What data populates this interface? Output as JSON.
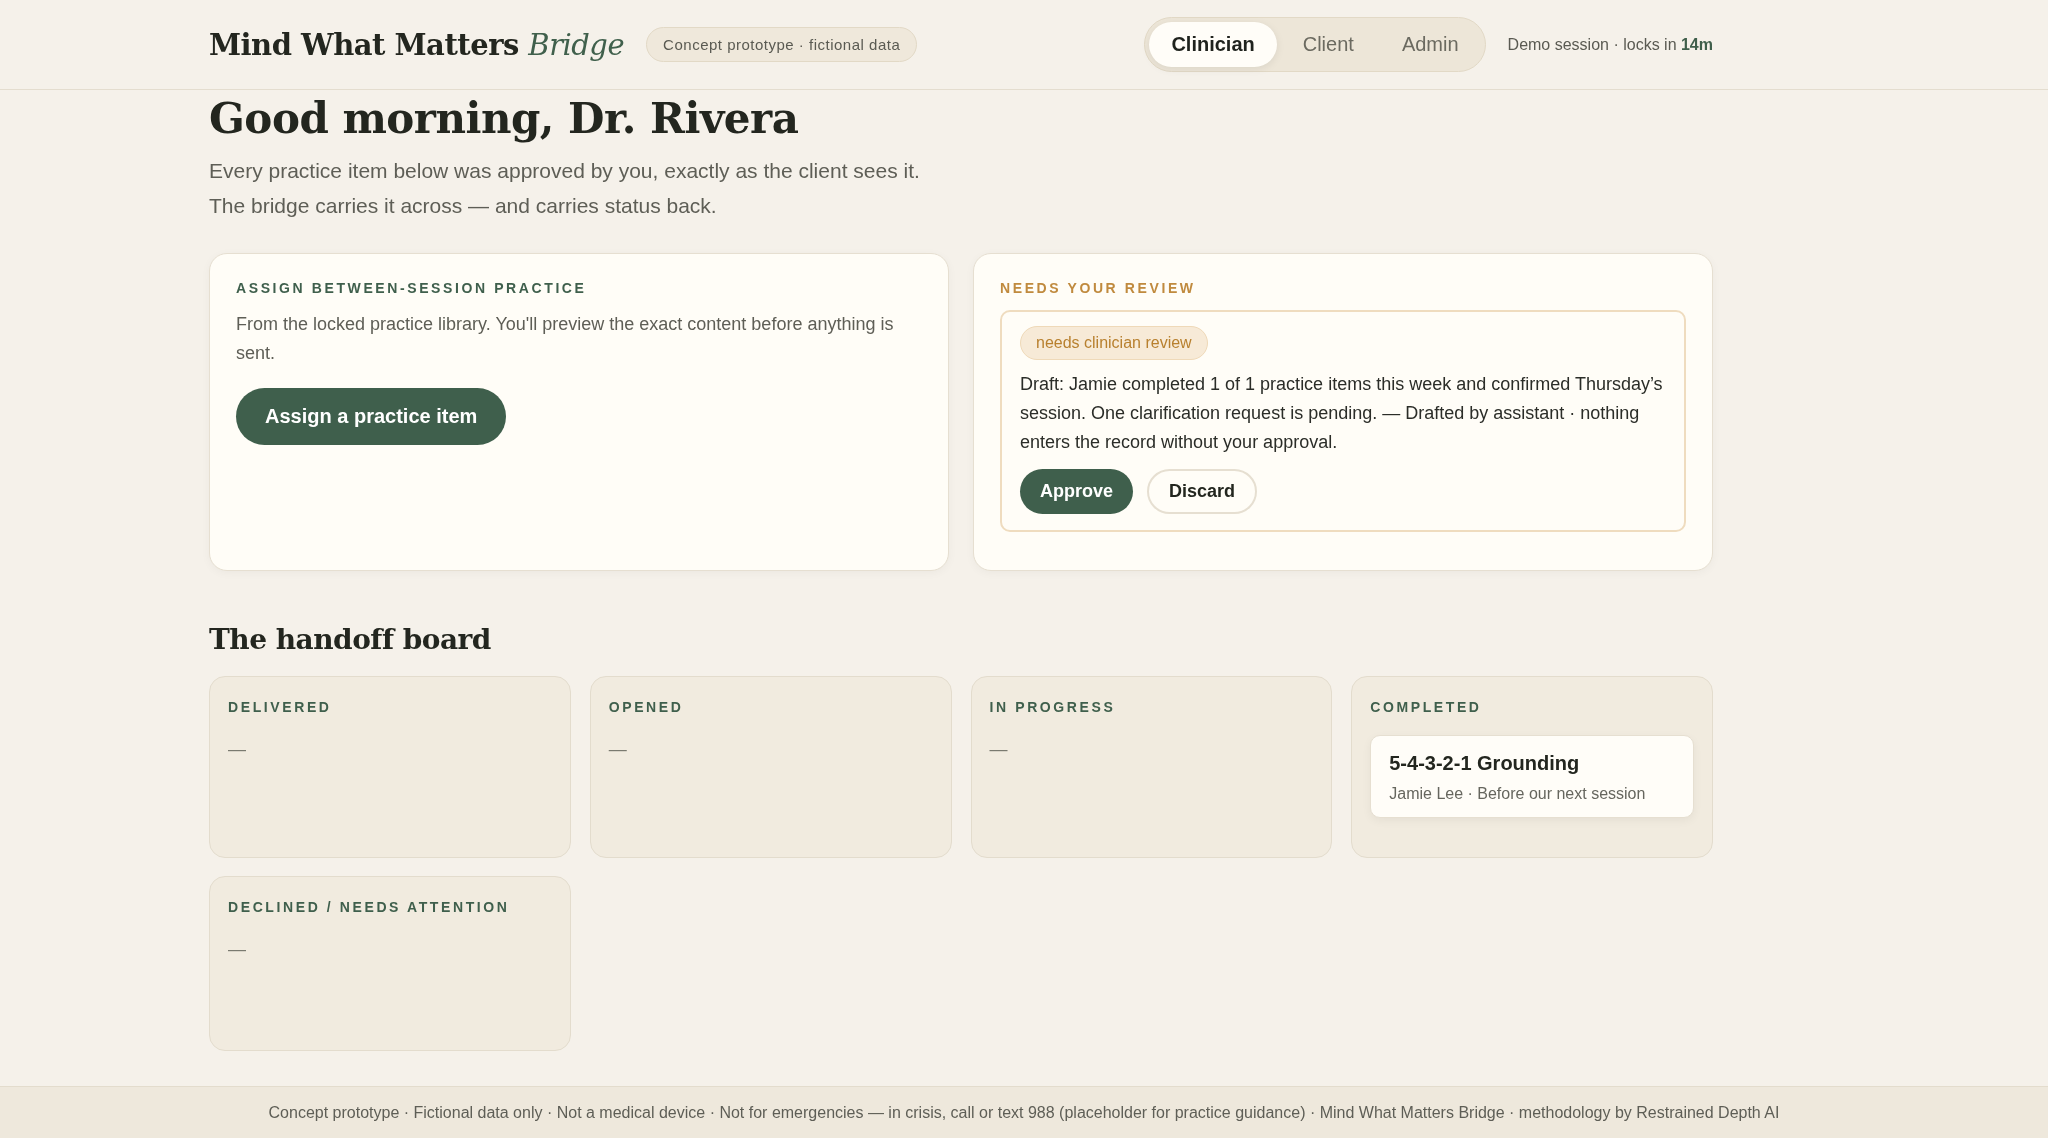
{
  "header": {
    "brand": "Mind What Matters",
    "brand_accent": "Bridge",
    "badge": "Concept prototype · fictional data",
    "roles": [
      {
        "label": "Clinician",
        "selected": true
      },
      {
        "label": "Client",
        "selected": false
      },
      {
        "label": "Admin",
        "selected": false
      }
    ],
    "session": "Demo session · locks in **14m**"
  },
  "greeting": {
    "title": "Good morning, Dr. Rivera",
    "lines": [
      "Every practice item below was approved by you, exactly as the client sees it.",
      "The bridge carries it across — and carries status back."
    ]
  },
  "assign_card": {
    "heading": "ASSIGN BETWEEN-SESSION PRACTICE",
    "text": "From the locked practice library. You'll preview the exact content before anything is sent.",
    "button": "Assign a practice item"
  },
  "review_card": {
    "heading": "NEEDS YOUR REVIEW",
    "tag": "needs clinician review",
    "draft": "Draft: Jamie completed 1 of 1 practice items this week and confirmed Thursday’s session. One clarification request is pending. — Drafted by assistant · nothing enters the record without your approval.",
    "buttons": [
      {
        "label": "Approve",
        "kind": "primary"
      },
      {
        "label": "Discard",
        "kind": "secondary"
      }
    ]
  },
  "board": {
    "title": "The handoff board",
    "columns": [
      {
        "heading": "DELIVERED",
        "empty": "—"
      },
      {
        "heading": "OPENED",
        "empty": "—"
      },
      {
        "heading": "IN PROGRESS",
        "empty": "—"
      },
      {
        "heading": "COMPLETED",
        "items": [
          {
            "title": "5-4-3-2-1 Grounding",
            "meta": "Jamie Lee · Before our next session"
          }
        ]
      },
      {
        "heading": "DECLINED / NEEDS ATTENTION",
        "empty": "—"
      }
    ]
  },
  "footer": "Concept prototype · Fictional data only · Not a medical device · Not for emergencies — in crisis, call or text 988 (placeholder for practice guidance) · Mind What Matters Bridge · methodology by Restrained Depth AI"
}
